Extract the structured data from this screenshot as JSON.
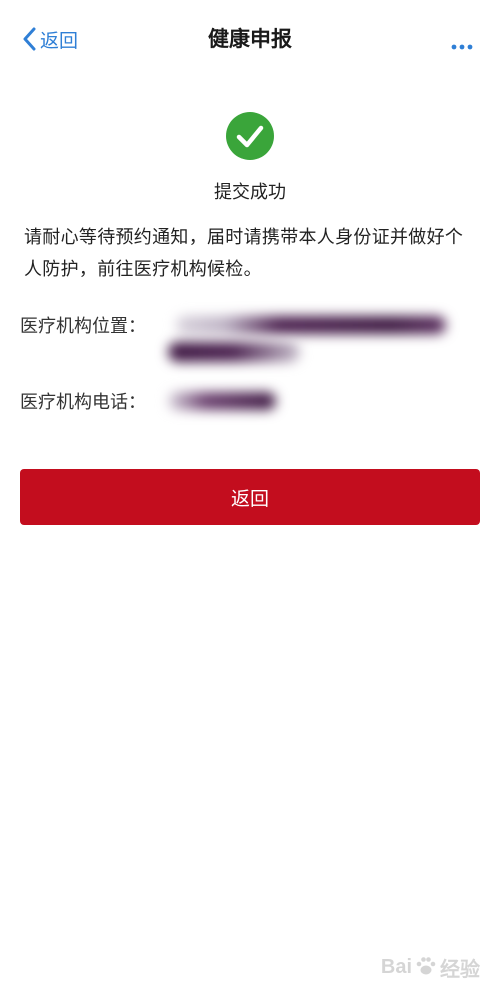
{
  "header": {
    "back_label": "返回",
    "title": "健康申报",
    "more_icon": "more-horizontal-icon"
  },
  "success": {
    "icon": "check-circle-icon",
    "icon_color": "#3aa53a",
    "status": "提交成功"
  },
  "notice": "请耐心等待预约通知，届时请携带本人身份证并做好个人防护，前往医疗机构候检。",
  "info": {
    "location_label": "医疗机构位置：",
    "phone_label": "医疗机构电话："
  },
  "button": {
    "label": "返回",
    "color": "#c30d1e"
  },
  "watermark": {
    "left": "Bai",
    "right": "经验"
  },
  "colors": {
    "link": "#2f7fd6"
  }
}
